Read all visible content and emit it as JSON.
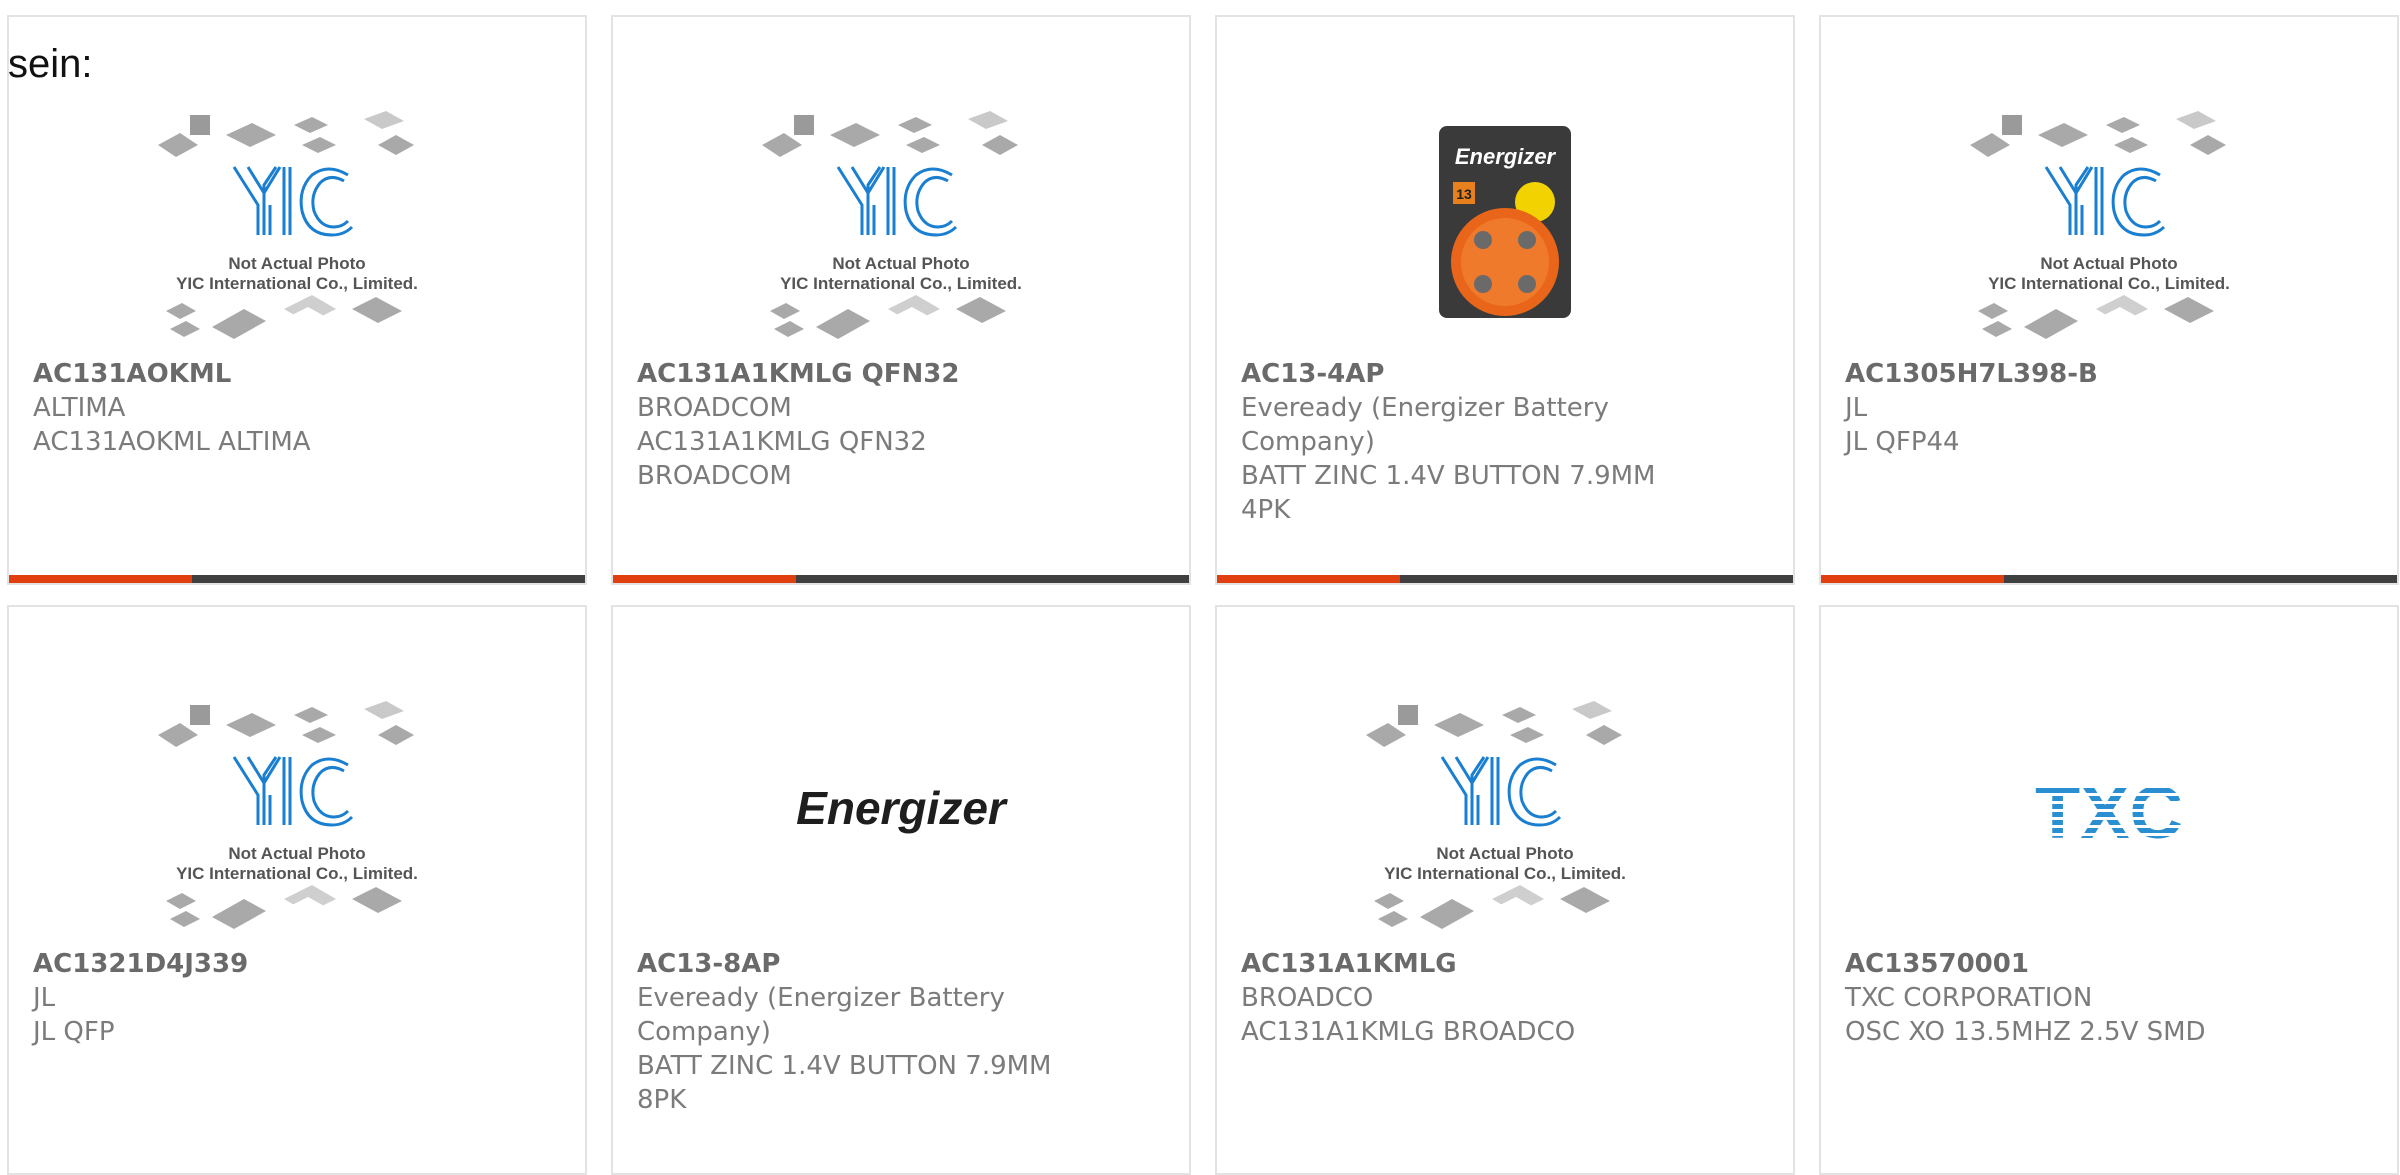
{
  "lead_text": "sein:",
  "placeholder_photo": {
    "logo_text": "YIC",
    "caption_line1": "Not Actual Photo",
    "caption_line2": "YIC International Co., Limited."
  },
  "battery_pack": {
    "brand": "Energizer",
    "size": "13"
  },
  "energizer_logo": "Energizer",
  "txc_logo": "TXC",
  "colors": {
    "accent": "#e0400f",
    "bar": "#404040",
    "yic_blue": "#1a7fd0",
    "txc_blue": "#2a8fd0"
  },
  "cards": [
    {
      "title": "AC131AOKML",
      "line1": "ALTIMA",
      "line2": "AC131AOKML ALTIMA",
      "image": "placeholder-photo"
    },
    {
      "title": "AC131A1KMLG QFN32",
      "line1": "BROADCOM",
      "line2": "AC131A1KMLG QFN32 BROADCOM",
      "image": "placeholder-photo"
    },
    {
      "title": "AC13-4AP",
      "line1": "Eveready (Energizer Battery Company)",
      "line2": "BATT ZINC 1.4V BUTTON 7.9MM 4PK",
      "image": "battery-pack"
    },
    {
      "title": "AC1305H7L398-B",
      "line1": "JL",
      "line2": "JL QFP44",
      "image": "placeholder-photo"
    },
    {
      "title": "AC1321D4J339",
      "line1": "JL",
      "line2": "JL QFP",
      "image": "placeholder-photo"
    },
    {
      "title": "AC13-8AP",
      "line1": "Eveready (Energizer Battery Company)",
      "line2": "BATT ZINC 1.4V BUTTON 7.9MM 8PK",
      "image": "energizer-logo"
    },
    {
      "title": "AC131A1KMLG",
      "line1": "BROADCO",
      "line2": "AC131A1KMLG BROADCO",
      "image": "placeholder-photo"
    },
    {
      "title": "AC13570001",
      "line1": "TXC CORPORATION",
      "line2": "OSC XO 13.5MHZ 2.5V SMD",
      "image": "txc-logo"
    }
  ]
}
